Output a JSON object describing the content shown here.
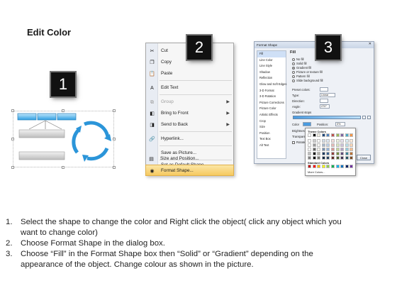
{
  "title": "Edit Color",
  "badges": [
    "1",
    "2",
    "3"
  ],
  "context_menu": {
    "items": [
      {
        "label": "Cut",
        "icon": "scissors-icon",
        "glyph": "✂",
        "underline": "t"
      },
      {
        "label": "Copy",
        "icon": "copy-icon",
        "glyph": "❐"
      },
      {
        "label": "Paste",
        "icon": "paste-icon",
        "glyph": "📋"
      },
      {
        "label": "Edit Text",
        "icon": "edit-text-icon",
        "glyph": "A"
      },
      {
        "label": "Group",
        "icon": "group-icon",
        "glyph": "⧉",
        "submenu": true,
        "disabled": true
      },
      {
        "label": "Bring to Front",
        "icon": "bring-to-front-icon",
        "glyph": "◧",
        "submenu": true
      },
      {
        "label": "Send to Back",
        "icon": "send-to-back-icon",
        "glyph": "◨",
        "submenu": true
      },
      {
        "label": "Hyperlink...",
        "icon": "hyperlink-icon",
        "glyph": "🔗"
      },
      {
        "label": "Save as Picture...",
        "icon": "",
        "glyph": ""
      },
      {
        "label": "Set as Default Shape",
        "icon": "",
        "glyph": ""
      },
      {
        "label": "Size and Position...",
        "icon": "size-position-icon",
        "glyph": "▤"
      },
      {
        "label": "Format Shape...",
        "icon": "format-shape-icon",
        "glyph": "◉",
        "highlighted": true
      }
    ]
  },
  "format_dialog": {
    "title": "Format Shape",
    "close": "✕",
    "nav": [
      "Fill",
      "Line Color",
      "Line Style",
      "Shadow",
      "Reflection",
      "Glow and Soft Edges",
      "3-D Format",
      "3-D Rotation",
      "Picture Corrections",
      "Picture Color",
      "Artistic Effects",
      "Crop",
      "Size",
      "Position",
      "Text Box",
      "Alt Text"
    ],
    "heading": "Fill",
    "fill_options": [
      "No fill",
      "Solid fill",
      "Gradient fill",
      "Picture or texture fill",
      "Pattern fill",
      "Slide background fill"
    ],
    "selected_fill": "Gradient fill",
    "fields": {
      "preset": "Preset colors:",
      "type": "Type:",
      "type_value": "Linear",
      "direction": "Direction:",
      "angle": "Angle:",
      "angle_value": "270°",
      "stops": "Gradient stops",
      "color": "Color",
      "position": "Position:",
      "position_value": "0%",
      "brightness": "Brightness:",
      "transparency": "Transparency:",
      "rotate": "Rotate with shape",
      "close_btn": "Close"
    }
  },
  "color_picker": {
    "theme_label": "Theme Colors",
    "standard_label": "Standard Colors",
    "more": "More Colors...",
    "theme_top": [
      "#ffffff",
      "#000000",
      "#eeece1",
      "#1f497d",
      "#4f81bd",
      "#c0504d",
      "#9bbb59",
      "#8064a2",
      "#4bacc6",
      "#f79646"
    ],
    "standard": [
      "#c00000",
      "#ff0000",
      "#ffc000",
      "#ffff00",
      "#92d050",
      "#00b050",
      "#00b0f0",
      "#0070c0",
      "#002060",
      "#7030a0"
    ]
  },
  "instructions": [
    {
      "num": "1.",
      "lines": [
        "Select the shape to change the color and Right click the object( click any object which you",
        "want to change color)"
      ]
    },
    {
      "num": "2.",
      "lines": [
        "Choose Format Shape in the dialog box."
      ]
    },
    {
      "num": "3.",
      "lines": [
        "Choose “Fill” in the Format Shape box then “Solid” or “Gradient” depending on the",
        "appearance of the object. Change colour as shown in the picture."
      ]
    }
  ]
}
